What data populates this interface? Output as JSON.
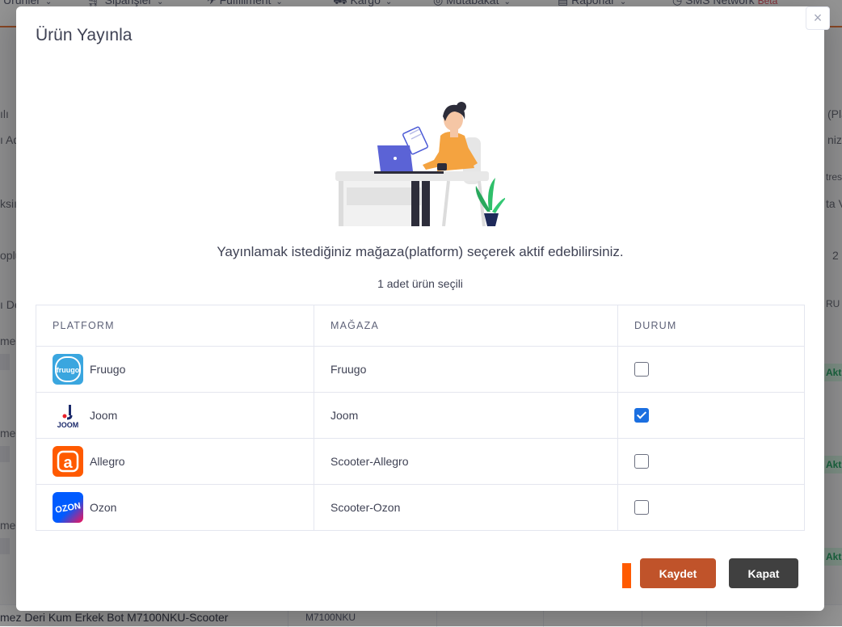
{
  "background": {
    "nav": [
      {
        "label": "Ürünler"
      },
      {
        "label": "Siparişler"
      },
      {
        "label": "Fulfillment"
      },
      {
        "label": "Kargo"
      },
      {
        "label": "Mutabakat"
      },
      {
        "label": "Raporlar"
      },
      {
        "label": "SMS Network"
      }
    ],
    "beta_badge": "Beta",
    "fragments": {
      "left": [
        "ılı",
        "ı Ad",
        "ksiı",
        "oplu",
        "ı Deı",
        "mez",
        "mez",
        "mez"
      ],
      "right": [
        "(Pla",
        "niz",
        "tres",
        "ta V",
        "2",
        "RU"
      ],
      "active_pill": "Aktif"
    },
    "bottom_row": {
      "title": "mez Deri Kum Erkek Bot M7100NKU-Scooter",
      "code": "M7100NKU"
    }
  },
  "modal": {
    "title": "Ürün Yayınla",
    "close_glyph": "×",
    "subtitle": "Yayınlamak istediğiniz mağaza(platform) seçerek aktif edebilirsiniz.",
    "selected_count": "1 adet ürün seçili",
    "table": {
      "headers": {
        "platform": "PLATFORM",
        "store": "MAĞAZA",
        "status": "DURUM"
      },
      "rows": [
        {
          "platform": "Fruugo",
          "store": "Fruugo",
          "checked": false,
          "logo_text": "fruugo",
          "logo_color": "#3aa6df"
        },
        {
          "platform": "Joom",
          "store": "Joom",
          "checked": true,
          "logo_text": "JOOM",
          "logo_color": "#1b2a6b"
        },
        {
          "platform": "Allegro",
          "store": "Scooter-Allegro",
          "checked": false,
          "logo_text": "a",
          "logo_color": "#ff5a00"
        },
        {
          "platform": "Ozon",
          "store": "Scooter-Ozon",
          "checked": false,
          "logo_text": "OZON",
          "logo_color": "#005bff"
        }
      ]
    },
    "buttons": {
      "save": "Kaydet",
      "close": "Kapat"
    },
    "colors": {
      "save": "#c0532a",
      "close": "#404040",
      "checkbox_active": "#1b6fe0",
      "accent": "#ff5a00"
    }
  }
}
